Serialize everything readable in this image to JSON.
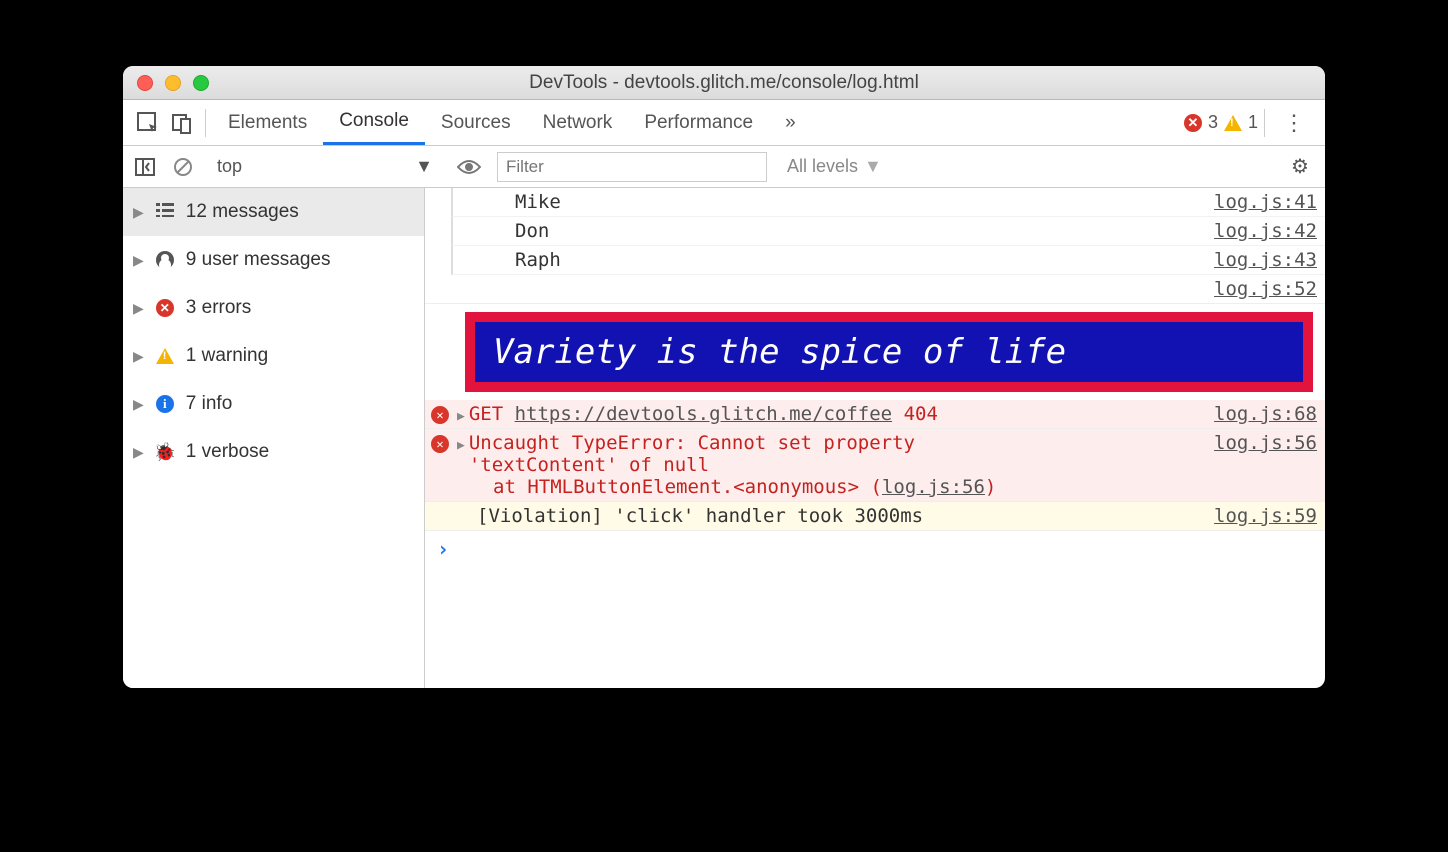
{
  "window": {
    "title": "DevTools - devtools.glitch.me/console/log.html"
  },
  "tabs": {
    "items": [
      "Elements",
      "Console",
      "Sources",
      "Network",
      "Performance"
    ],
    "active_index": 1,
    "overflow_glyph": "»",
    "error_count": "3",
    "warn_count": "1"
  },
  "filter": {
    "context": "top",
    "placeholder": "Filter",
    "levels_label": "All levels"
  },
  "sidebar": {
    "items": [
      {
        "icon": "list",
        "label": "12 messages",
        "selected": true
      },
      {
        "icon": "user",
        "label": "9 user messages"
      },
      {
        "icon": "error",
        "label": "3 errors"
      },
      {
        "icon": "warn",
        "label": "1 warning"
      },
      {
        "icon": "info",
        "label": "7 info"
      },
      {
        "icon": "bug",
        "label": "1 verbose"
      }
    ]
  },
  "logs": {
    "indented": [
      {
        "text": "Mike",
        "src": "log.js:41"
      },
      {
        "text": "Don",
        "src": "log.js:42"
      },
      {
        "text": "Raph",
        "src": "log.js:43"
      }
    ],
    "styled": {
      "text": "Variety is the spice of life",
      "src": "log.js:52"
    },
    "get_error": {
      "method": "GET",
      "url": "https://devtools.glitch.me/coffee",
      "status": "404",
      "src": "log.js:68"
    },
    "type_error": {
      "line1": "Uncaught TypeError: Cannot set property",
      "line2": "'textContent' of null",
      "stack_prefix": "at HTMLButtonElement.",
      "stack_anon": "<anonymous>",
      "stack_loc": "log.js:56",
      "src": "log.js:56"
    },
    "violation": {
      "text": "[Violation] 'click' handler took 3000ms",
      "src": "log.js:59"
    },
    "prompt": "›"
  }
}
